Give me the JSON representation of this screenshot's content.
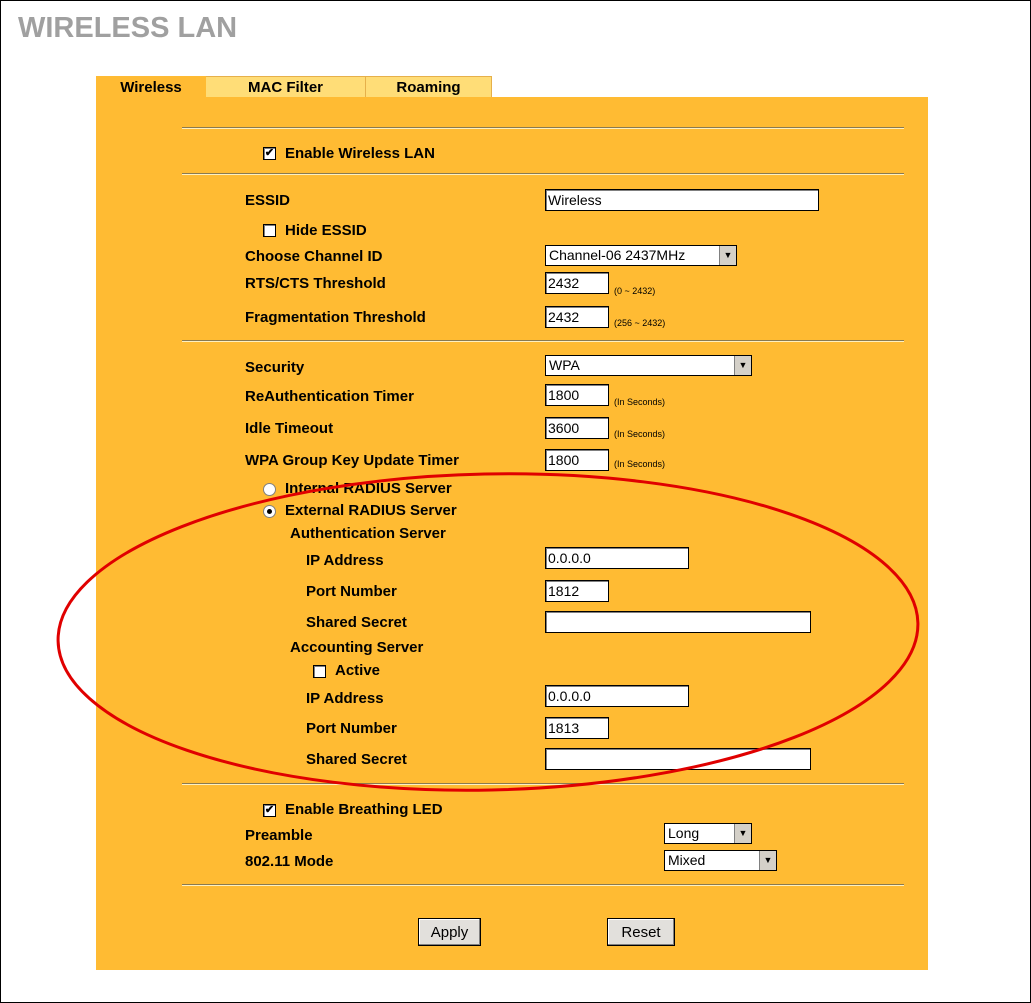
{
  "page": {
    "title": "WIRELESS LAN"
  },
  "tabs": [
    {
      "label": "Wireless"
    },
    {
      "label": "MAC Filter"
    },
    {
      "label": "Roaming"
    }
  ],
  "wireless": {
    "enable_label": "Enable Wireless LAN",
    "enabled": true
  },
  "essid": {
    "label": "ESSID",
    "value": "Wireless",
    "hide_label": "Hide ESSID",
    "hide_checked": false
  },
  "channel": {
    "label": "Choose Channel ID",
    "value": "Channel-06 2437MHz"
  },
  "rts": {
    "label": "RTS/CTS  Threshold",
    "value": "2432",
    "hint": "(0 ~ 2432)"
  },
  "frag": {
    "label": "Fragmentation  Threshold",
    "value": "2432",
    "hint": "(256 ~ 2432)"
  },
  "security": {
    "label": "Security",
    "value": "WPA"
  },
  "reauth": {
    "label": "ReAuthentication Timer",
    "value": "1800",
    "hint": "(In Seconds)"
  },
  "idle": {
    "label": "Idle Timeout",
    "value": "3600",
    "hint": "(In Seconds)"
  },
  "wpa_group": {
    "label": "WPA Group Key Update Timer",
    "value": "1800",
    "hint": "(In Seconds)"
  },
  "radius": {
    "internal_label": "Internal RADIUS Server",
    "external_label": "External RADIUS Server",
    "selected": "external"
  },
  "auth_server": {
    "heading": "Authentication Server",
    "ip_label": "IP Address",
    "ip_value": "0.0.0.0",
    "port_label": "Port Number",
    "port_value": "1812",
    "secret_label": "Shared Secret",
    "secret_value": ""
  },
  "acct_server": {
    "heading": "Accounting Server",
    "active_label": "Active",
    "active_checked": false,
    "ip_label": "IP Address",
    "ip_value": "0.0.0.0",
    "port_label": "Port Number",
    "port_value": "1813",
    "secret_label": "Shared Secret",
    "secret_value": ""
  },
  "breathing": {
    "label": "Enable Breathing LED",
    "checked": true
  },
  "preamble": {
    "label": "Preamble",
    "value": "Long"
  },
  "mode": {
    "label": "802.11 Mode",
    "value": "Mixed"
  },
  "buttons": {
    "apply": "Apply",
    "reset": "Reset"
  },
  "colors": {
    "panel": "#ffbb33",
    "tab_inactive": "#ffdd77",
    "title": "#a0a0a0",
    "annotation": "#e00000"
  },
  "icons": {
    "checkbox_checked": "✔",
    "dropdown_arrow": "▼"
  }
}
